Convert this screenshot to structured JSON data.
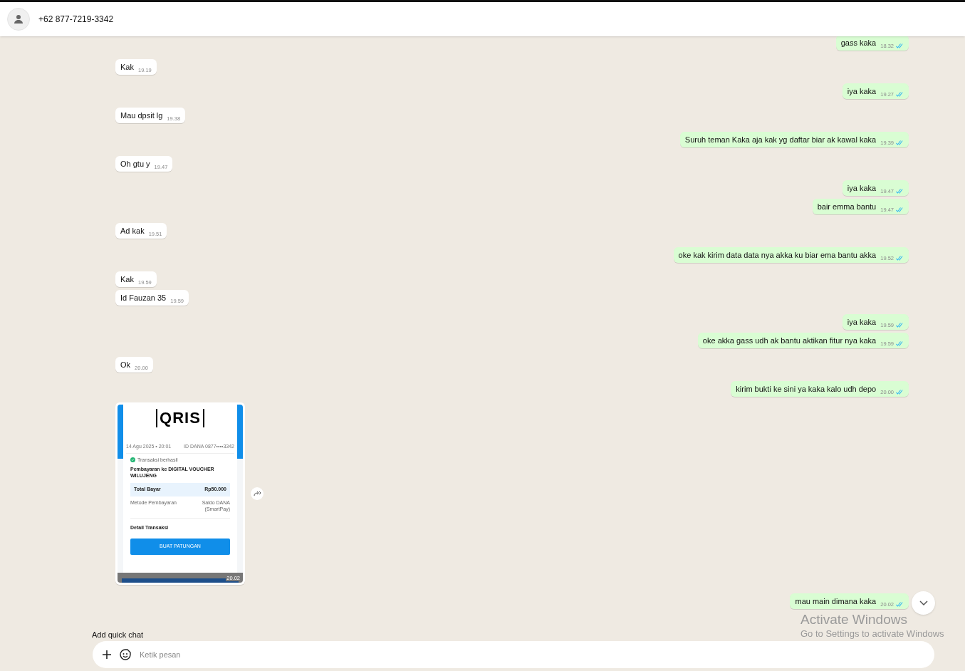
{
  "header": {
    "contact": "+62 877-7219-3342"
  },
  "messages": [
    {
      "kind": "text",
      "outgoing": true,
      "text": "gass kaka",
      "time": "18.32",
      "read": true
    },
    {
      "kind": "text",
      "outgoing": false,
      "text": "Kak",
      "time": "19.19"
    },
    {
      "kind": "text",
      "outgoing": true,
      "text": "iya kaka",
      "time": "19.27",
      "read": true
    },
    {
      "kind": "text",
      "outgoing": false,
      "text": "Mau dpsit lg",
      "time": "19.38"
    },
    {
      "kind": "text",
      "outgoing": true,
      "text": "Suruh teman Kaka aja kak yg daftar biar ak kawal kaka",
      "time": "19.39",
      "read": true
    },
    {
      "kind": "text",
      "outgoing": false,
      "text": "Oh gtu y",
      "time": "19.47"
    },
    {
      "kind": "text",
      "outgoing": true,
      "text": "iya kaka",
      "time": "19.47",
      "read": true
    },
    {
      "kind": "text",
      "outgoing": true,
      "text": "bair emma bantu",
      "time": "19.47",
      "read": true
    },
    {
      "kind": "text",
      "outgoing": false,
      "text": "Ad kak",
      "time": "19.51"
    },
    {
      "kind": "text",
      "outgoing": true,
      "text": "oke kak kirim data data nya akka ku biar ema bantu akka",
      "time": "19.52",
      "read": true
    },
    {
      "kind": "text",
      "outgoing": false,
      "text": "Kak",
      "time": "19.59"
    },
    {
      "kind": "text",
      "outgoing": false,
      "text": "Id Fauzan 35",
      "time": "19.59"
    },
    {
      "kind": "text",
      "outgoing": true,
      "text": "iya kaka",
      "time": "19.59",
      "read": true
    },
    {
      "kind": "text",
      "outgoing": true,
      "text": "oke akka gass udh ak bantu aktikan fitur nya kaka",
      "time": "19.59",
      "read": true
    },
    {
      "kind": "text",
      "outgoing": false,
      "text": "Ok",
      "time": "20.00"
    },
    {
      "kind": "text",
      "outgoing": true,
      "text": "kirim bukti ke sini ya kaka kalo udh depo",
      "time": "20.00",
      "read": true
    },
    {
      "kind": "receipt",
      "outgoing": false,
      "time": "20.02",
      "receipt": {
        "logo": "QRIS",
        "date": "14 Agu 2025 • 20:01",
        "account": "ID DANA 0877••••3342",
        "status": "Transaksi berhasil",
        "title": "Pembayaran ke DIGITAL VOUCHER WILUJENG",
        "total_label": "Total Bayar",
        "total": "Rp50.000",
        "method_label": "Metode Pembayaran",
        "method": "Saldo DANA (SmartPay)",
        "details": "Detail Transaksi",
        "button": "BUAT PATUNGAN"
      }
    },
    {
      "kind": "text",
      "outgoing": true,
      "text": "mau main dimana kaka",
      "time": "20.02",
      "read": true
    }
  ],
  "quick_chat": "Add quick chat",
  "composer": {
    "placeholder": "Ketik pesan"
  },
  "os_overlay": {
    "title": "Activate Windows",
    "subtitle": "Go to Settings to activate Windows"
  }
}
